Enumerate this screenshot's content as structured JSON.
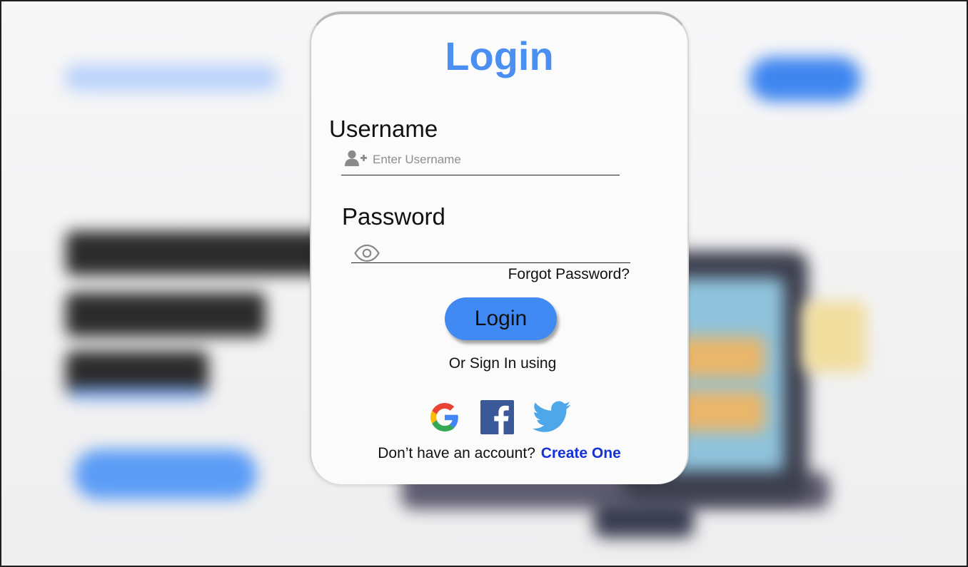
{
  "login_card": {
    "title": "Login",
    "username_label": "Username",
    "username_placeholder": "Enter Username",
    "username_icon": "add-user-icon",
    "password_label": "Password",
    "password_value": "",
    "password_icon": "eye-icon",
    "forgot_password": "Forgot Password?",
    "login_button": "Login",
    "alt_signin_text": "Or Sign In using",
    "social_providers": [
      "google-icon",
      "facebook-icon",
      "twitter-icon"
    ],
    "no_account_text": "Don’t have an account?",
    "create_account_link": "Create One"
  },
  "colors": {
    "accent": "#4189f3",
    "title": "#4a8ff1",
    "link": "#1532d6",
    "card_background": "#fcfbfb",
    "icon_gray": "#8a8a8a",
    "google_blue": "#4285F4",
    "google_red": "#EA4335",
    "google_yellow": "#FBBC05",
    "google_green": "#34A853",
    "facebook": "#3b5998",
    "twitter": "#4da7e8"
  },
  "background": {
    "description_state": "blurred landing page behind modal"
  }
}
